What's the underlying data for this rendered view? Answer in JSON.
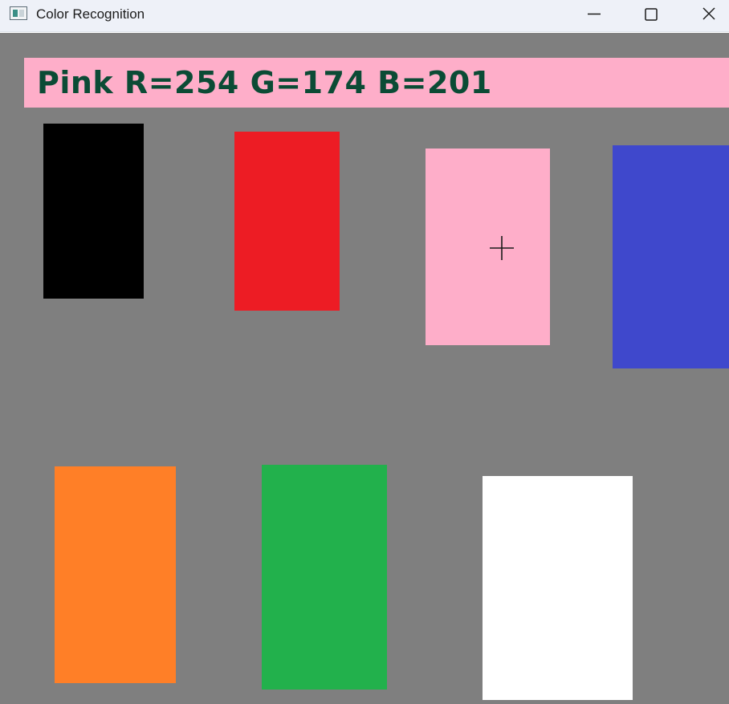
{
  "window": {
    "title": "Color Recognition",
    "controls": {
      "minimize_icon": "minimize-icon",
      "maximize_icon": "maximize-icon",
      "close_icon": "close-icon"
    }
  },
  "detection": {
    "text": "Pink R=254 G=174 B=201",
    "color_name": "Pink",
    "r": 254,
    "g": 174,
    "b": 201,
    "bar_color": "#feaec9",
    "text_color": "#0b4b35"
  },
  "canvas": {
    "background": "#7f7f7f",
    "cursor_icon": "crosshair-icon"
  },
  "swatches": [
    {
      "name": "black",
      "color": "#000000"
    },
    {
      "name": "red",
      "color": "#ed1c24"
    },
    {
      "name": "pink",
      "color": "#feaec9"
    },
    {
      "name": "blue",
      "color": "#3f48cc"
    },
    {
      "name": "orange",
      "color": "#ff7f27"
    },
    {
      "name": "green",
      "color": "#22b14c"
    },
    {
      "name": "white",
      "color": "#ffffff"
    }
  ]
}
